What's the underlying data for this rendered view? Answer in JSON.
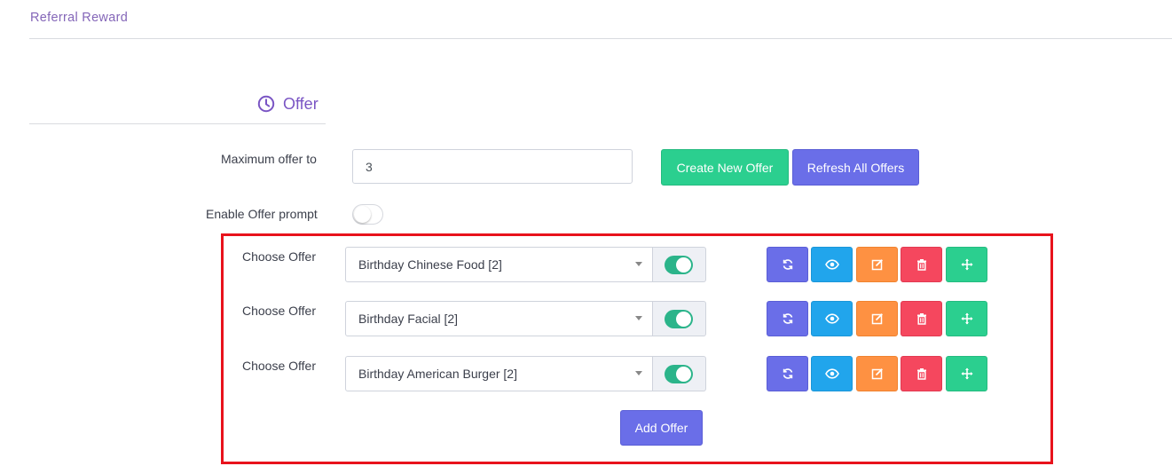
{
  "breadcrumb": "Referral Reward",
  "section": {
    "title": "Offer",
    "icon": "clock-icon"
  },
  "form": {
    "max_offer_label": "Maximum offer to",
    "max_offer_value": "3",
    "create_button": "Create New Offer",
    "refresh_button": "Refresh All Offers",
    "enable_prompt_label": "Enable Offer prompt",
    "enable_prompt_on": false
  },
  "offers": [
    {
      "label": "Choose Offer",
      "selected": "Birthday Chinese Food [2]",
      "enabled": true
    },
    {
      "label": "Choose Offer",
      "selected": "Birthday Facial [2]",
      "enabled": true
    },
    {
      "label": "Choose Offer",
      "selected": "Birthday American Burger [2]",
      "enabled": true
    }
  ],
  "row_actions": [
    "refresh-icon",
    "eye-icon",
    "edit-icon",
    "trash-icon",
    "move-icon"
  ],
  "add_offer_button": "Add Offer",
  "colors": {
    "accent": "#7a55c4",
    "green": "#2bcf8f",
    "indigo": "#6a6ee8",
    "blue": "#21a5ec",
    "orange": "#fe9142",
    "red": "#f5475e",
    "highlight": "#e8131c"
  }
}
